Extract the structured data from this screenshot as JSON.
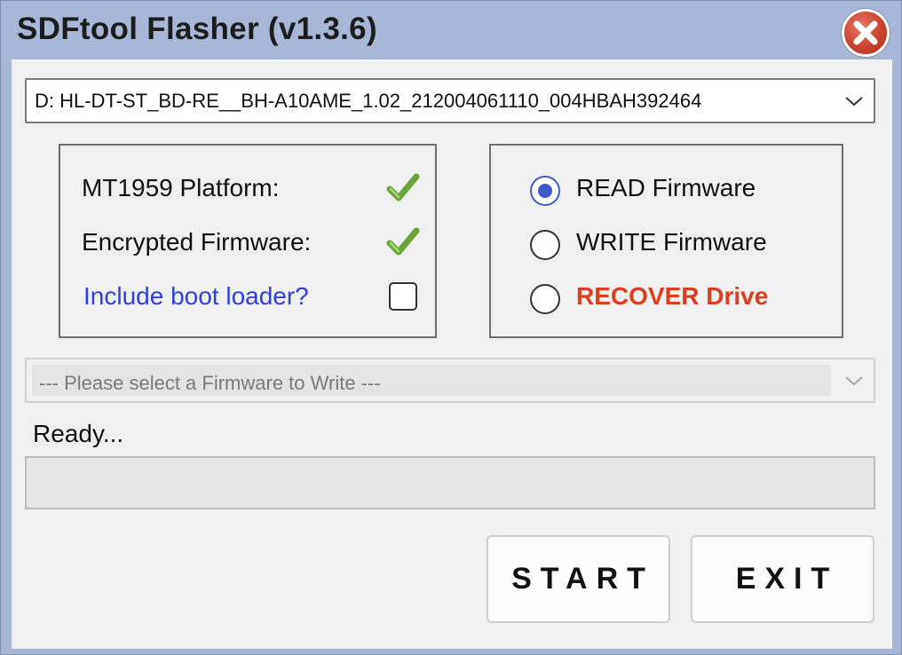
{
  "window": {
    "title": "SDFtool Flasher (v1.3.6)",
    "close_icon": "close-icon",
    "accent_color": "#a7b7d7"
  },
  "drive_select": {
    "value": "D:  HL-DT-ST_BD-RE__BH-A10AME_1.02_212004061110_004HBAH392464"
  },
  "drive_info": {
    "platform_label": "MT1959 Platform:",
    "platform_ok": true,
    "encrypted_label": "Encrypted Firmware:",
    "encrypted_ok": true,
    "bootloader_label": "Include boot loader?",
    "bootloader_checked": false,
    "check_icon": "checkmark-icon",
    "check_color": "#6aa53a"
  },
  "mode": {
    "options": [
      {
        "label": "READ Firmware",
        "selected": true
      },
      {
        "label": "WRITE Firmware",
        "selected": false
      },
      {
        "label": "RECOVER Drive",
        "selected": false,
        "color": "#d9401f"
      }
    ]
  },
  "firmware_select": {
    "placeholder": "--- Please select a Firmware to Write ---",
    "enabled": false
  },
  "status": {
    "text": "Ready...",
    "progress": 0
  },
  "buttons": {
    "start_label": "START",
    "exit_label": "EXIT"
  }
}
